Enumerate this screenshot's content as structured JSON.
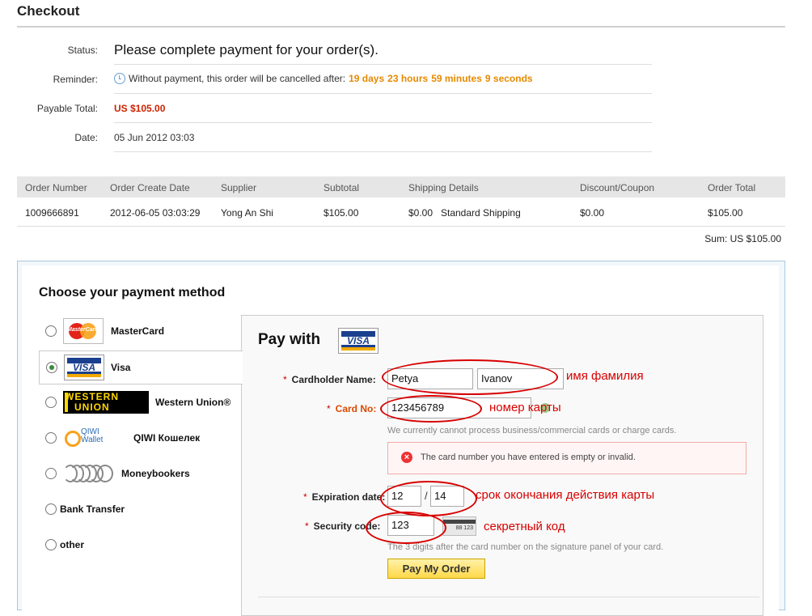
{
  "page": {
    "title": "Checkout"
  },
  "summary": {
    "status_label": "Status:",
    "status_text": "Please complete payment for your order(s).",
    "reminder_label": "Reminder:",
    "reminder_prefix": "Without payment, this order will be cancelled after:",
    "reminder_days": "19 days",
    "reminder_hours": "23 hours",
    "reminder_minutes": "59 minutes",
    "reminder_seconds": "9 seconds",
    "payable_label": "Payable Total:",
    "payable_value": "US $105.00",
    "date_label": "Date:",
    "date_value": "05 Jun 2012 03:03"
  },
  "order_table": {
    "headers": [
      "Order Number",
      "Order Create Date",
      "Supplier",
      "Subtotal",
      "Shipping Details",
      "Discount/Coupon",
      "Order Total"
    ],
    "row": {
      "order_number": "1009666891",
      "create_date": "2012-06-05 03:03:29",
      "supplier": "Yong An Shi",
      "subtotal": "$105.00",
      "shipping_cost": "$0.00",
      "shipping_method": "Standard Shipping",
      "discount": "$0.00",
      "total": "$105.00"
    },
    "sum": "Sum: US $105.00"
  },
  "payment": {
    "choose_title": "Choose your payment method",
    "methods": [
      {
        "label": "MasterCard",
        "logo_text": "MasterCard",
        "selected": false
      },
      {
        "label": "Visa",
        "logo_text": "VISA",
        "selected": true
      },
      {
        "label": "Western Union®",
        "logo_text_1": "WESTERN",
        "logo_text_2": "UNION",
        "selected": false
      },
      {
        "label": "QIWI Кошелек",
        "logo_text_1": "QIWI",
        "logo_text_2": "Wallet",
        "selected": false
      },
      {
        "label": "Moneybookers",
        "selected": false
      },
      {
        "label": "Bank Transfer",
        "selected": false
      },
      {
        "label": "other",
        "selected": false
      }
    ],
    "form": {
      "pay_with_title": "Pay with",
      "visa_logo_text": "VISA",
      "cardholder_label": "Cardholder Name:",
      "first_name": "Petya",
      "last_name": "Ivanov",
      "card_no_label": "Card No:",
      "card_no": "123456789",
      "card_hint": "We currently cannot process business/commercial cards or charge cards.",
      "error_text": "The card number you have entered is empty or invalid.",
      "expiration_label": "Expiration date:",
      "exp_month": "12",
      "exp_separator": "/",
      "exp_year": "14",
      "security_label": "Security code:",
      "security_code": "123",
      "cvv_card_digits": "88 123",
      "security_hint": "The 3 digits after the card number on the signature panel of your card.",
      "pay_button": "Pay My Order",
      "required_marker": "*"
    },
    "annotations": {
      "name": "имя фамилия",
      "card_number": "номер карты",
      "expiry": "срок окончания действия карты",
      "security": "секретный код"
    }
  },
  "colors": {
    "accent_orange": "#e68a00",
    "total_red": "#cc2200",
    "annotation_red": "#d80000",
    "button_yellow": "#ffd84a"
  }
}
